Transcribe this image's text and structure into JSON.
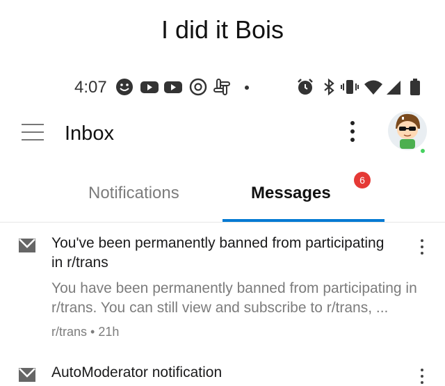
{
  "caption": "I did it Bois",
  "status_bar": {
    "time": "4:07",
    "left_icons": [
      "smiley-icon",
      "youtube-icon",
      "youtube-icon",
      "threads-icon",
      "slack-icon",
      "dot-icon"
    ],
    "right_icons": [
      "alarm-icon",
      "bluetooth-icon",
      "vibrate-icon",
      "wifi-icon",
      "signal-icon",
      "battery-icon"
    ]
  },
  "app_bar": {
    "title": "Inbox",
    "menu_icon": "hamburger-icon",
    "overflow_icon": "more-vertical-icon",
    "avatar_status_color": "#46d160"
  },
  "tabs": [
    {
      "label": "Notifications",
      "active": false
    },
    {
      "label": "Messages",
      "active": true,
      "badge": "6"
    }
  ],
  "accent_color": "#0079d3",
  "badge_color": "#e53935",
  "messages": [
    {
      "title": "You've been permanently banned from participating in r/trans",
      "body": "You have been permanently banned from participating in r/trans. You can still view and subscribe to r/trans, ...",
      "subreddit": "r/trans",
      "age": "21h"
    },
    {
      "title": "AutoModerator notification"
    }
  ]
}
